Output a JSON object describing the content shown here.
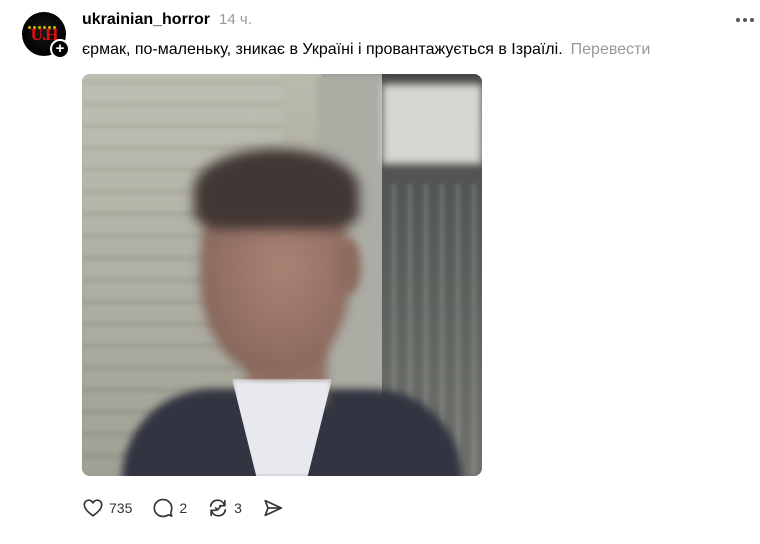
{
  "post": {
    "username": "ukrainian_horror",
    "time": "14 ч.",
    "caption": "єрмак, по-маленьку, зникає в Україні і провантажується в Ізраїлі.",
    "translate_label": "Перевести",
    "avatar_logo": "U.H",
    "follow_symbol": "+"
  },
  "actions": {
    "likes": "735",
    "replies": "2",
    "reposts": "3"
  },
  "icons": {
    "like": "heart-icon",
    "reply": "comment-icon",
    "repost": "repost-icon",
    "share": "send-icon",
    "more": "more-dots-icon"
  },
  "colors": {
    "text": "#000000",
    "muted": "#999999",
    "avatar_logo": "#e01010"
  }
}
